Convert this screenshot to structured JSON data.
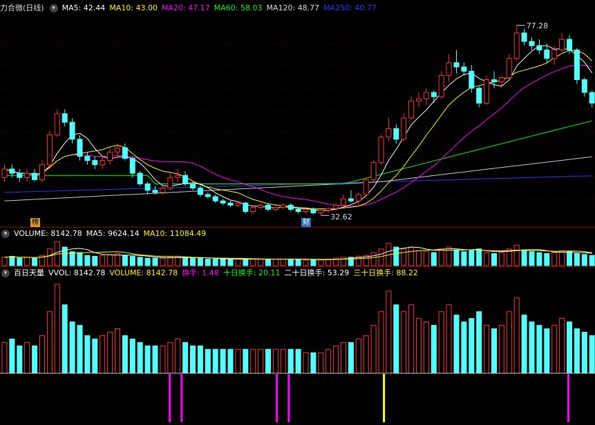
{
  "price_panel": {
    "title": "力合微(日线)",
    "ma": [
      {
        "label": "MA5: 42.44",
        "color": "#ffffff"
      },
      {
        "label": "MA10: 43.00",
        "color": "#ffff00"
      },
      {
        "label": "MA20: 47.17",
        "color": "#ff00ff"
      },
      {
        "label": "MA60: 58.03",
        "color": "#00ff00"
      },
      {
        "label": "MA120: 48.77",
        "color": "#dddddd"
      },
      {
        "label": "MA250: 40.77",
        "color": "#3333ff"
      }
    ],
    "high_label": "77.28",
    "low_label": "32.62",
    "tag_bang": "榜",
    "tag_cai": "财"
  },
  "volume_panel": {
    "labels": [
      {
        "label": "VOLUME: 8142.78",
        "color": "#ffffff"
      },
      {
        "label": "MA5: 9624.14",
        "color": "#ffffff"
      },
      {
        "label": "MA10: 11084.49",
        "color": "#ffff00"
      }
    ]
  },
  "indicator_panel": {
    "labels": [
      {
        "label": "百日天量",
        "color": "#ffffff"
      },
      {
        "label": "VVOL: 8142.78",
        "color": "#ffffff"
      },
      {
        "label": "VOLUME: 8142.78",
        "color": "#ffff00"
      },
      {
        "label": "换手: 1.48",
        "color": "#ff00ff"
      },
      {
        "label": "十日换手: 20.11",
        "color": "#00ff00"
      },
      {
        "label": "二十日换手: 53.29",
        "color": "#ffffff"
      },
      {
        "label": "三十日换手: 88.22",
        "color": "#ffff00"
      }
    ]
  },
  "colors": {
    "up": "#ff3232",
    "down": "#54ffff",
    "ma5": "#ffffff",
    "ma10": "#ffff00",
    "ma20": "#ff00ff",
    "ma60": "#00ff00",
    "ma120": "#cccccc",
    "ma250": "#3333ff"
  },
  "chart_data": {
    "type": "candlestick",
    "ylim": [
      31,
      80
    ],
    "candles": [
      {
        "o": 41.5,
        "h": 44.5,
        "l": 40.5,
        "c": 43.5
      },
      {
        "o": 43.5,
        "h": 44.5,
        "l": 41.5,
        "c": 42.5
      },
      {
        "o": 42.5,
        "h": 43.5,
        "l": 40.5,
        "c": 41.5
      },
      {
        "o": 41.5,
        "h": 43.5,
        "l": 40.5,
        "c": 42.5
      },
      {
        "o": 42.5,
        "h": 43.5,
        "l": 40.5,
        "c": 41.0
      },
      {
        "o": 41.0,
        "h": 45.5,
        "l": 40.5,
        "c": 44.5
      },
      {
        "o": 44.5,
        "h": 52.5,
        "l": 44.0,
        "c": 51.5
      },
      {
        "o": 51.5,
        "h": 57.5,
        "l": 51.0,
        "c": 56.5
      },
      {
        "o": 56.5,
        "h": 57.5,
        "l": 53.5,
        "c": 54.5
      },
      {
        "o": 54.5,
        "h": 55.5,
        "l": 49.5,
        "c": 50.5
      },
      {
        "o": 50.5,
        "h": 51.5,
        "l": 45.5,
        "c": 46.5
      },
      {
        "o": 46.5,
        "h": 47.5,
        "l": 44.5,
        "c": 45.5
      },
      {
        "o": 45.5,
        "h": 46.5,
        "l": 43.5,
        "c": 44.5
      },
      {
        "o": 44.5,
        "h": 46.5,
        "l": 43.5,
        "c": 45.5
      },
      {
        "o": 45.5,
        "h": 48.5,
        "l": 44.5,
        "c": 47.5
      },
      {
        "o": 47.5,
        "h": 49.5,
        "l": 46.5,
        "c": 48.5
      },
      {
        "o": 48.5,
        "h": 49.5,
        "l": 45.5,
        "c": 46.0
      },
      {
        "o": 46.0,
        "h": 46.5,
        "l": 41.5,
        "c": 42.5
      },
      {
        "o": 42.5,
        "h": 43.0,
        "l": 39.5,
        "c": 40.0
      },
      {
        "o": 40.0,
        "h": 40.5,
        "l": 37.5,
        "c": 38.5
      },
      {
        "o": 38.5,
        "h": 39.5,
        "l": 37.5,
        "c": 38.0
      },
      {
        "o": 38.0,
        "h": 39.5,
        "l": 37.5,
        "c": 39.0
      },
      {
        "o": 39.0,
        "h": 42.5,
        "l": 38.5,
        "c": 41.5
      },
      {
        "o": 41.5,
        "h": 43.5,
        "l": 40.5,
        "c": 42.0
      },
      {
        "o": 42.0,
        "h": 43.0,
        "l": 39.5,
        "c": 40.0
      },
      {
        "o": 40.0,
        "h": 40.5,
        "l": 38.5,
        "c": 39.0
      },
      {
        "o": 39.0,
        "h": 39.5,
        "l": 37.0,
        "c": 37.5
      },
      {
        "o": 37.5,
        "h": 38.0,
        "l": 36.5,
        "c": 37.0
      },
      {
        "o": 37.0,
        "h": 37.5,
        "l": 35.5,
        "c": 36.0
      },
      {
        "o": 36.0,
        "h": 36.5,
        "l": 35.0,
        "c": 35.5
      },
      {
        "o": 35.5,
        "h": 36.0,
        "l": 34.5,
        "c": 35.0
      },
      {
        "o": 35.0,
        "h": 36.0,
        "l": 34.5,
        "c": 35.5
      },
      {
        "o": 35.5,
        "h": 35.8,
        "l": 33.0,
        "c": 33.5
      },
      {
        "o": 33.5,
        "h": 35.0,
        "l": 33.0,
        "c": 34.5
      },
      {
        "o": 34.5,
        "h": 35.5,
        "l": 34.0,
        "c": 35.0
      },
      {
        "o": 35.0,
        "h": 35.5,
        "l": 33.5,
        "c": 34.0
      },
      {
        "o": 34.0,
        "h": 35.0,
        "l": 33.5,
        "c": 34.5
      },
      {
        "o": 34.5,
        "h": 35.5,
        "l": 34.0,
        "c": 35.0
      },
      {
        "o": 35.0,
        "h": 35.5,
        "l": 33.5,
        "c": 34.0
      },
      {
        "o": 34.0,
        "h": 34.5,
        "l": 33.0,
        "c": 33.5
      },
      {
        "o": 33.5,
        "h": 34.5,
        "l": 33.0,
        "c": 34.0
      },
      {
        "o": 34.0,
        "h": 34.5,
        "l": 32.8,
        "c": 33.2
      },
      {
        "o": 33.2,
        "h": 34.0,
        "l": 32.6,
        "c": 33.8
      },
      {
        "o": 33.8,
        "h": 34.5,
        "l": 33.2,
        "c": 34.2
      },
      {
        "o": 34.2,
        "h": 35.5,
        "l": 33.8,
        "c": 35.0
      },
      {
        "o": 35.0,
        "h": 37.5,
        "l": 34.5,
        "c": 36.5
      },
      {
        "o": 36.5,
        "h": 38.5,
        "l": 35.5,
        "c": 36.0
      },
      {
        "o": 36.0,
        "h": 38.0,
        "l": 35.0,
        "c": 37.5
      },
      {
        "o": 37.5,
        "h": 41.5,
        "l": 37.0,
        "c": 41.0
      },
      {
        "o": 41.0,
        "h": 45.5,
        "l": 40.5,
        "c": 45.0
      },
      {
        "o": 45.0,
        "h": 51.5,
        "l": 44.5,
        "c": 51.0
      },
      {
        "o": 51.0,
        "h": 55.5,
        "l": 50.0,
        "c": 53.0
      },
      {
        "o": 53.0,
        "h": 54.0,
        "l": 49.5,
        "c": 50.5
      },
      {
        "o": 50.5,
        "h": 56.5,
        "l": 50.0,
        "c": 55.5
      },
      {
        "o": 55.5,
        "h": 60.5,
        "l": 55.0,
        "c": 59.5
      },
      {
        "o": 59.5,
        "h": 61.5,
        "l": 58.0,
        "c": 60.0
      },
      {
        "o": 60.0,
        "h": 62.5,
        "l": 58.5,
        "c": 61.5
      },
      {
        "o": 61.5,
        "h": 62.0,
        "l": 59.0,
        "c": 60.5
      },
      {
        "o": 60.5,
        "h": 66.5,
        "l": 60.0,
        "c": 65.5
      },
      {
        "o": 65.5,
        "h": 70.5,
        "l": 64.0,
        "c": 68.5
      },
      {
        "o": 68.5,
        "h": 71.5,
        "l": 66.0,
        "c": 67.5
      },
      {
        "o": 67.5,
        "h": 68.5,
        "l": 65.5,
        "c": 66.5
      },
      {
        "o": 66.5,
        "h": 68.0,
        "l": 61.5,
        "c": 62.5
      },
      {
        "o": 62.5,
        "h": 63.0,
        "l": 58.0,
        "c": 59.0
      },
      {
        "o": 59.0,
        "h": 65.5,
        "l": 58.5,
        "c": 64.5
      },
      {
        "o": 64.5,
        "h": 66.5,
        "l": 62.5,
        "c": 64.0
      },
      {
        "o": 64.0,
        "h": 65.5,
        "l": 62.5,
        "c": 65.0
      },
      {
        "o": 65.0,
        "h": 70.5,
        "l": 64.5,
        "c": 69.5
      },
      {
        "o": 69.5,
        "h": 77.28,
        "l": 69.0,
        "c": 75.5
      },
      {
        "o": 75.5,
        "h": 76.5,
        "l": 72.5,
        "c": 73.5
      },
      {
        "o": 73.5,
        "h": 74.5,
        "l": 71.5,
        "c": 72.5
      },
      {
        "o": 72.5,
        "h": 74.0,
        "l": 70.5,
        "c": 71.5
      },
      {
        "o": 71.5,
        "h": 73.0,
        "l": 68.5,
        "c": 69.5
      },
      {
        "o": 69.5,
        "h": 72.5,
        "l": 68.0,
        "c": 71.5
      },
      {
        "o": 71.5,
        "h": 75.5,
        "l": 71.0,
        "c": 74.0
      },
      {
        "o": 74.0,
        "h": 75.0,
        "l": 70.5,
        "c": 71.5
      },
      {
        "o": 71.5,
        "h": 72.0,
        "l": 63.5,
        "c": 64.5
      },
      {
        "o": 64.5,
        "h": 65.0,
        "l": 60.5,
        "c": 61.5
      },
      {
        "o": 61.5,
        "h": 62.0,
        "l": 58.0,
        "c": 59.0
      }
    ],
    "volume": [
      9,
      10,
      8,
      9,
      8,
      11,
      18,
      26,
      20,
      15,
      14,
      11,
      10,
      11,
      12,
      13,
      11,
      10,
      9,
      8,
      8,
      8,
      9,
      10,
      9,
      8,
      8,
      7,
      7,
      7,
      7,
      7,
      7,
      7,
      7,
      7,
      7,
      7,
      7,
      7,
      6,
      6,
      6,
      7,
      8,
      9,
      9,
      10,
      11,
      14,
      18,
      24,
      20,
      18,
      20,
      16,
      15,
      14,
      18,
      20,
      17,
      15,
      16,
      18,
      14,
      13,
      14,
      18,
      22,
      17,
      15,
      14,
      13,
      14,
      16,
      15,
      13,
      12,
      11
    ],
    "vol_up": [
      1,
      0,
      0,
      1,
      0,
      1,
      1,
      1,
      0,
      0,
      0,
      0,
      0,
      1,
      1,
      1,
      0,
      0,
      0,
      0,
      0,
      1,
      1,
      1,
      0,
      0,
      0,
      0,
      0,
      0,
      0,
      1,
      0,
      1,
      1,
      0,
      1,
      1,
      0,
      0,
      1,
      0,
      1,
      1,
      1,
      1,
      0,
      1,
      1,
      1,
      1,
      1,
      0,
      1,
      1,
      1,
      1,
      0,
      1,
      1,
      0,
      0,
      0,
      0,
      1,
      0,
      1,
      1,
      1,
      0,
      0,
      0,
      0,
      1,
      1,
      0,
      0,
      0,
      0
    ],
    "turnover_markers": [
      {
        "i": 28,
        "color": "#ff00ff"
      },
      {
        "i": 30,
        "color": "#ff00ff"
      },
      {
        "i": 46,
        "color": "#ff00ff"
      },
      {
        "i": 48,
        "color": "#ff00ff"
      },
      {
        "i": 64,
        "color": "#ffff00"
      },
      {
        "i": 95,
        "color": "#ff00ff"
      }
    ]
  }
}
